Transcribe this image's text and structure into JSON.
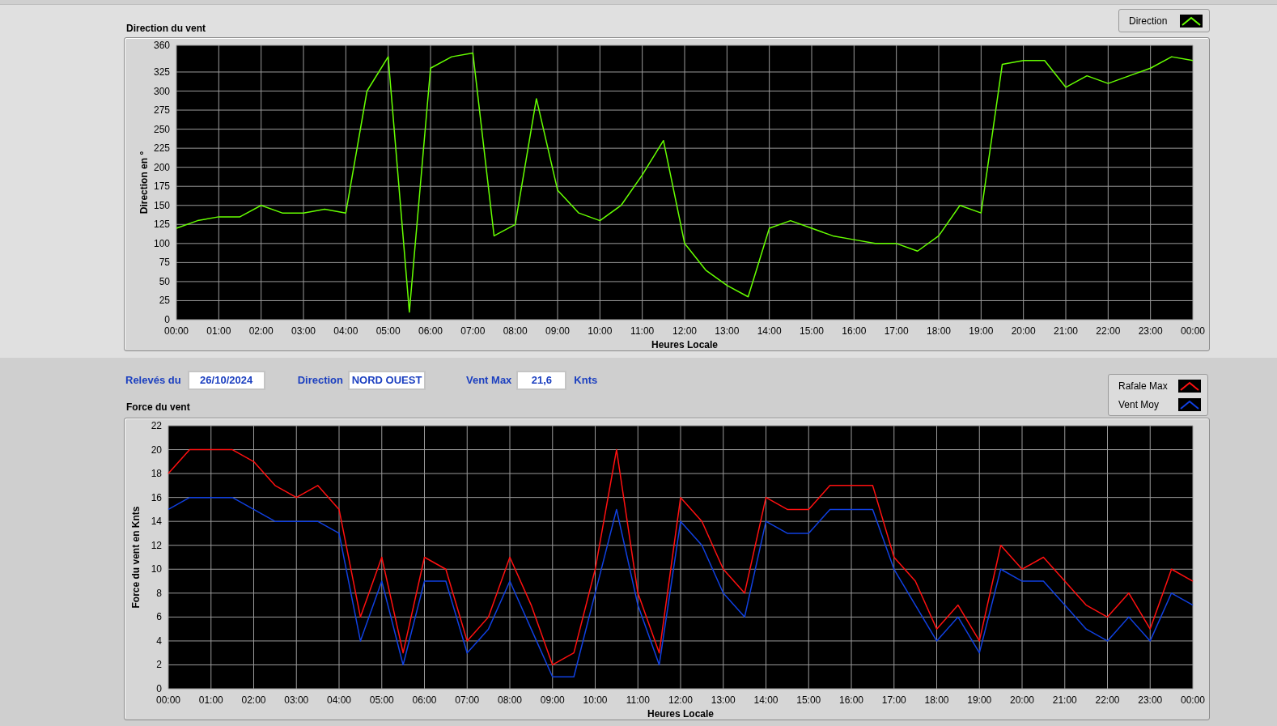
{
  "direction_chart": {
    "title": "Direction du vent",
    "chart_data": {
      "type": "line",
      "grid": true,
      "xlabel": "Heures Locale",
      "ylabel": "Direction en °",
      "xlim": [
        0,
        24
      ],
      "ylim": [
        0,
        360
      ],
      "x": [
        0,
        0.5,
        1,
        1.5,
        2,
        2.5,
        3,
        3.5,
        4,
        4.5,
        5,
        5.5,
        6,
        6.5,
        7,
        7.5,
        8,
        8.5,
        9,
        9.5,
        10,
        10.5,
        11,
        11.5,
        12,
        12.5,
        13,
        13.5,
        14,
        14.5,
        15,
        15.5,
        16,
        16.5,
        17,
        17.5,
        18,
        18.5,
        19,
        19.5,
        20,
        20.5,
        21,
        21.5,
        22,
        22.5,
        23,
        23.5,
        24
      ],
      "series": [
        {
          "name": "Direction",
          "color": "#66ff00",
          "values": [
            120,
            130,
            135,
            135,
            150,
            140,
            140,
            145,
            140,
            300,
            345,
            10,
            330,
            345,
            350,
            110,
            125,
            290,
            170,
            140,
            130,
            150,
            190,
            235,
            100,
            65,
            45,
            30,
            120,
            130,
            120,
            110,
            105,
            100,
            100,
            90,
            110,
            150,
            140,
            335,
            340,
            340,
            305,
            320,
            310,
            320,
            330,
            345,
            340
          ]
        }
      ],
      "xticks": [
        {
          "value": 0,
          "label": "00:00"
        },
        {
          "value": 1,
          "label": "01:00"
        },
        {
          "value": 2,
          "label": "02:00"
        },
        {
          "value": 3,
          "label": "03:00"
        },
        {
          "value": 4,
          "label": "04:00"
        },
        {
          "value": 5,
          "label": "05:00"
        },
        {
          "value": 6,
          "label": "06:00"
        },
        {
          "value": 7,
          "label": "07:00"
        },
        {
          "value": 8,
          "label": "08:00"
        },
        {
          "value": 9,
          "label": "09:00"
        },
        {
          "value": 10,
          "label": "10:00"
        },
        {
          "value": 11,
          "label": "11:00"
        },
        {
          "value": 12,
          "label": "12:00"
        },
        {
          "value": 13,
          "label": "13:00"
        },
        {
          "value": 14,
          "label": "14:00"
        },
        {
          "value": 15,
          "label": "15:00"
        },
        {
          "value": 16,
          "label": "16:00"
        },
        {
          "value": 17,
          "label": "17:00"
        },
        {
          "value": 18,
          "label": "18:00"
        },
        {
          "value": 19,
          "label": "19:00"
        },
        {
          "value": 20,
          "label": "20:00"
        },
        {
          "value": 21,
          "label": "21:00"
        },
        {
          "value": 22,
          "label": "22:00"
        },
        {
          "value": 23,
          "label": "23:00"
        },
        {
          "value": 24,
          "label": "00:00"
        }
      ],
      "yticks": [
        0,
        25,
        50,
        75,
        100,
        125,
        150,
        175,
        200,
        225,
        250,
        275,
        300,
        325,
        360
      ]
    }
  },
  "readings": {
    "date_label": "Relevés du",
    "date": "26/10/2024",
    "direction_label": "Direction",
    "direction": "NORD OUEST",
    "max_label": "Vent Max",
    "max": "21,6",
    "unit": "Knts"
  },
  "force_chart": {
    "title": "Force du vent",
    "chart_data": {
      "type": "line",
      "grid": true,
      "xlabel": "Heures Locale",
      "ylabel": "Force du vent en Knts",
      "xlim": [
        0,
        24
      ],
      "ylim": [
        0,
        22
      ],
      "x": [
        0,
        0.5,
        1,
        1.5,
        2,
        2.5,
        3,
        3.5,
        4,
        4.5,
        5,
        5.5,
        6,
        6.5,
        7,
        7.5,
        8,
        8.5,
        9,
        9.5,
        10,
        10.5,
        11,
        11.5,
        12,
        12.5,
        13,
        13.5,
        14,
        14.5,
        15,
        15.5,
        16,
        16.5,
        17,
        17.5,
        18,
        18.5,
        19,
        19.5,
        20,
        20.5,
        21,
        21.5,
        22,
        22.5,
        23,
        23.5,
        24
      ],
      "series": [
        {
          "name": "Rafale Max",
          "color": "#ff1010",
          "values": [
            18,
            20,
            20,
            20,
            19,
            17,
            16,
            17,
            15,
            6,
            11,
            3,
            11,
            10,
            4,
            6,
            11,
            7,
            2,
            3,
            10,
            20,
            8,
            3,
            16,
            14,
            10,
            8,
            16,
            15,
            15,
            17,
            17,
            17,
            11,
            9,
            5,
            7,
            4,
            12,
            10,
            11,
            9,
            7,
            6,
            8,
            5,
            10,
            9
          ]
        },
        {
          "name": "Vent Moy",
          "color": "#1040e0",
          "values": [
            15,
            16,
            16,
            16,
            15,
            14,
            14,
            14,
            13,
            4,
            9,
            2,
            9,
            9,
            3,
            5,
            9,
            5,
            1,
            1,
            8,
            15,
            7,
            2,
            14,
            12,
            8,
            6,
            14,
            13,
            13,
            15,
            15,
            15,
            10,
            7,
            4,
            6,
            3,
            10,
            9,
            9,
            7,
            5,
            4,
            6,
            4,
            8,
            7
          ]
        }
      ],
      "xticks": [
        {
          "value": 0,
          "label": "00:00"
        },
        {
          "value": 1,
          "label": "01:00"
        },
        {
          "value": 2,
          "label": "02:00"
        },
        {
          "value": 3,
          "label": "03:00"
        },
        {
          "value": 4,
          "label": "04:00"
        },
        {
          "value": 5,
          "label": "05:00"
        },
        {
          "value": 6,
          "label": "06:00"
        },
        {
          "value": 7,
          "label": "07:00"
        },
        {
          "value": 8,
          "label": "08:00"
        },
        {
          "value": 9,
          "label": "09:00"
        },
        {
          "value": 10,
          "label": "10:00"
        },
        {
          "value": 11,
          "label": "11:00"
        },
        {
          "value": 12,
          "label": "12:00"
        },
        {
          "value": 13,
          "label": "13:00"
        },
        {
          "value": 14,
          "label": "14:00"
        },
        {
          "value": 15,
          "label": "15:00"
        },
        {
          "value": 16,
          "label": "16:00"
        },
        {
          "value": 17,
          "label": "17:00"
        },
        {
          "value": 18,
          "label": "18:00"
        },
        {
          "value": 19,
          "label": "19:00"
        },
        {
          "value": 20,
          "label": "20:00"
        },
        {
          "value": 21,
          "label": "21:00"
        },
        {
          "value": 22,
          "label": "22:00"
        },
        {
          "value": 23,
          "label": "23:00"
        },
        {
          "value": 24,
          "label": "00:00"
        }
      ],
      "yticks": [
        0,
        2,
        4,
        6,
        8,
        10,
        12,
        14,
        16,
        18,
        20,
        22
      ]
    }
  }
}
